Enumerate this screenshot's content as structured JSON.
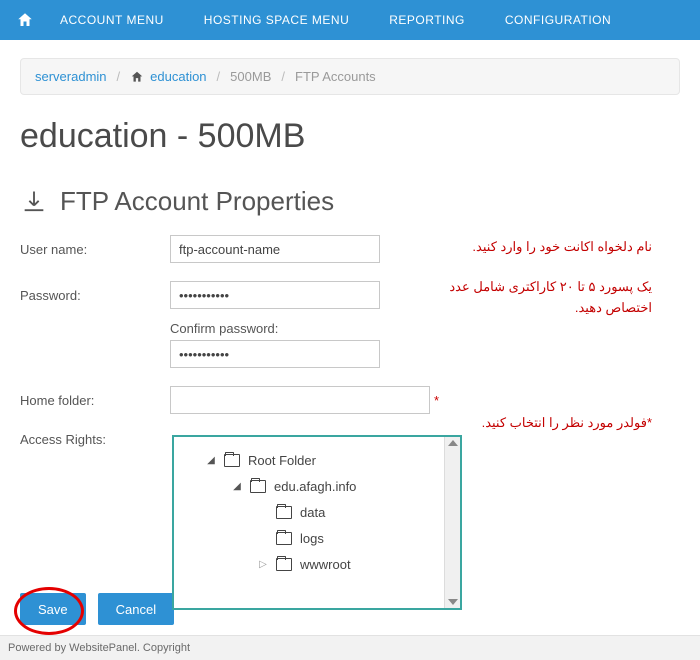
{
  "nav": {
    "items": [
      "ACCOUNT MENU",
      "HOSTING SPACE MENU",
      "REPORTING",
      "CONFIGURATION"
    ]
  },
  "breadcrumb": {
    "admin": "serveradmin",
    "space": "education",
    "plan": "500MB",
    "section": "FTP Accounts"
  },
  "page_title": "education - 500MB",
  "section_title": "FTP Account Properties",
  "form": {
    "username_label": "User name:",
    "username_value": "ftp-account-name",
    "password_label": "Password:",
    "password_value": "•••••••••••",
    "confirm_label": "Confirm password:",
    "confirm_value": "•••••••••••",
    "homefolder_label": "Home folder:",
    "homefolder_value": "",
    "access_label": "Access Rights:",
    "required_mark": "*"
  },
  "tree": {
    "root": "Root Folder",
    "level1": "edu.afagh.info",
    "children": [
      "data",
      "logs",
      "wwwroot"
    ]
  },
  "buttons": {
    "save": "Save",
    "cancel": "Cancel"
  },
  "annotations": {
    "a1": "نام دلخواه اکانت خود را وارد کنید.",
    "a2": "یک پسورد ۵ تا ۲۰ کاراکتری شامل عدد اختصاص دهید.",
    "a3": "فولدر مورد نظر را انتخاب کنید."
  },
  "footer": "Powered by WebsitePanel. Copyright"
}
